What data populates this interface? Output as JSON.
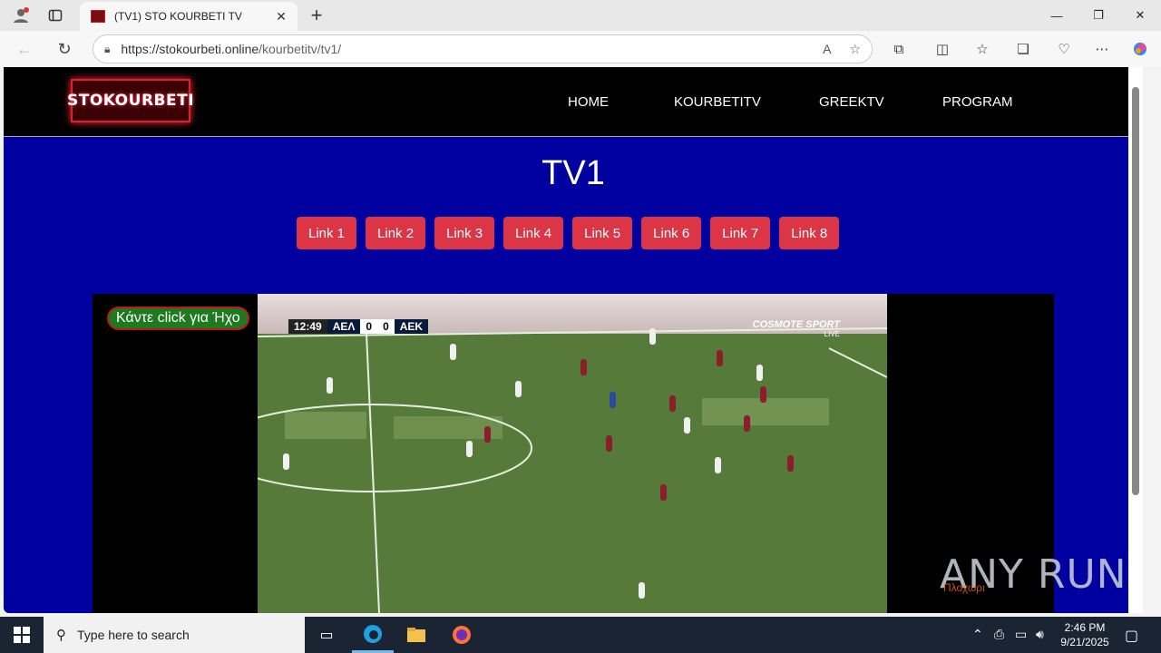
{
  "browser": {
    "tab_title": "(TV1) STO KOURBETI TV",
    "url_host": "https://stokourbeti.online",
    "url_path": "/kourbetitv/tv1/"
  },
  "site": {
    "logo_text": "STOKOURBETI",
    "nav": [
      "HOME",
      "KOURBETITV",
      "GREEKTV",
      "PROGRAM"
    ],
    "heading": "TV1",
    "links": [
      "Link 1",
      "Link 2",
      "Link 3",
      "Link 4",
      "Link 5",
      "Link 6",
      "Link 7",
      "Link 8"
    ],
    "colors": {
      "page_bg": "#0000a0",
      "link_button": "#dc3545",
      "header_bg": "#000000"
    }
  },
  "player": {
    "sound_button": "Κάντε click για Ήχο",
    "scorebug": {
      "time": "12:49",
      "home": "ΑΕΛ",
      "home_score": "0",
      "away_score": "0",
      "away": "ΑΕΚ"
    },
    "broadcaster": "COSMOTE SPORT",
    "broadcaster_sub": "LIVE"
  },
  "watermark": {
    "text": "ANY RUN",
    "sub": "Πλοχωρι"
  },
  "taskbar": {
    "search_placeholder": "Type here to search",
    "time": "2:46 PM",
    "date": "9/21/2025"
  }
}
